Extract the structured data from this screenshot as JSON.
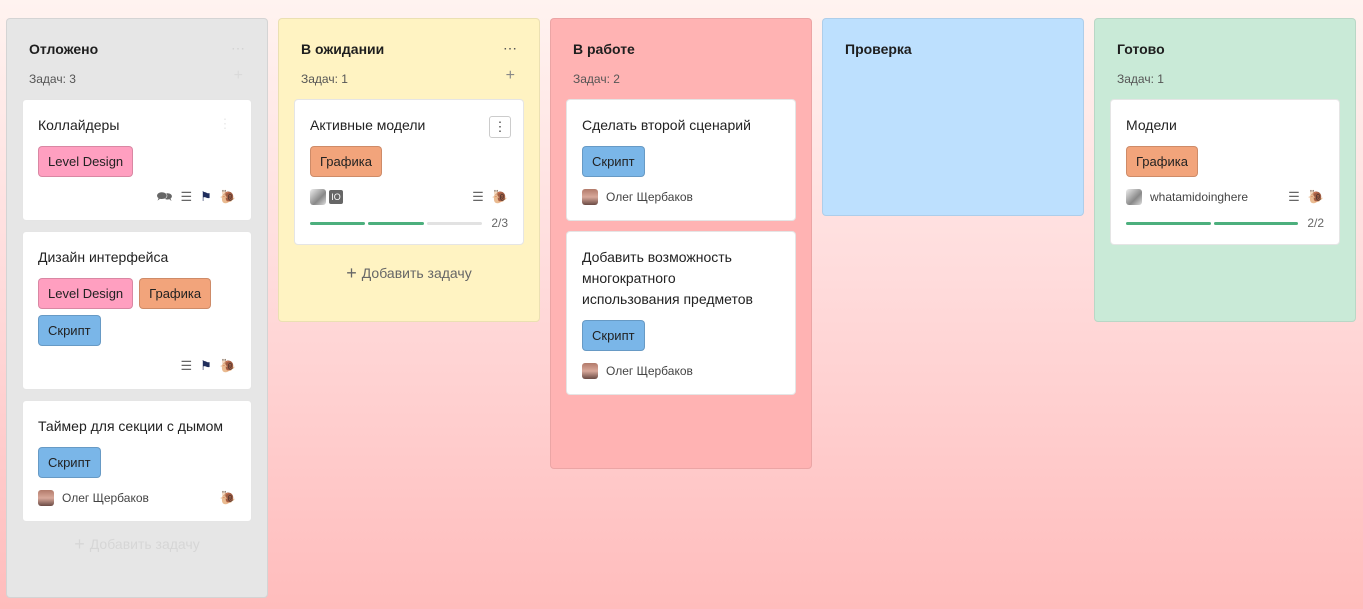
{
  "columns": [
    {
      "title": "Отложено",
      "count": "Задач: 3",
      "menu_icon": "more-icon",
      "add_icon": "plus-icon",
      "color": "#e6e6e6",
      "add_task_label": "Добавить задачу",
      "cards": [
        {
          "title": "Коллайдеры",
          "tags": [
            "Level Design"
          ],
          "icons": [
            "comment-icon",
            "description-icon",
            "flag-icon",
            "snail-icon"
          ]
        },
        {
          "title": "Дизайн интерфейса",
          "tags": [
            "Level Design",
            "Графика",
            "Скрипт"
          ],
          "icons": [
            "description-icon",
            "flag-icon",
            "snail-icon"
          ]
        },
        {
          "title": "Таймер для секции с дымом",
          "tags": [
            "Скрипт"
          ],
          "user": "Олег Щербаков",
          "icons": [
            "snail-icon"
          ]
        }
      ]
    },
    {
      "title": "В ожидании",
      "count": "Задач: 1",
      "menu_icon": "more-icon",
      "add_icon": "plus-icon",
      "color": "#fff3c2",
      "add_task_label": "Добавить задачу",
      "cards": [
        {
          "title": "Активные модели",
          "tags": [
            "Графика"
          ],
          "avatar_badge": "IO",
          "icons": [
            "description-icon",
            "snail-icon"
          ],
          "progress": {
            "done": 2,
            "total": 3,
            "label": "2/3"
          }
        }
      ]
    },
    {
      "title": "В работе",
      "count": "Задач: 2",
      "color": "#ffb3b3",
      "cards": [
        {
          "title": "Сделать второй сценарий",
          "tags": [
            "Скрипт"
          ],
          "user": "Олег Щербаков"
        },
        {
          "title": "Добавить возможность многократного использования предметов",
          "tags": [
            "Скрипт"
          ],
          "user": "Олег Щербаков"
        }
      ]
    },
    {
      "title": "Проверка",
      "color": "#bde0fe"
    },
    {
      "title": "Готово",
      "count": "Задач: 1",
      "color": "#c9ead7",
      "cards": [
        {
          "title": "Модели",
          "tags": [
            "Графика"
          ],
          "user": "whatamidoinghere",
          "icons": [
            "description-icon",
            "snail-icon"
          ],
          "progress": {
            "done": 2,
            "total": 2,
            "label": "2/2"
          }
        }
      ]
    }
  ],
  "tag_colors": {
    "Level Design": "#ff9fc0",
    "Графика": "#f2a47b",
    "Скрипт": "#7ab6e8"
  },
  "progress_color": "#4caf7d"
}
